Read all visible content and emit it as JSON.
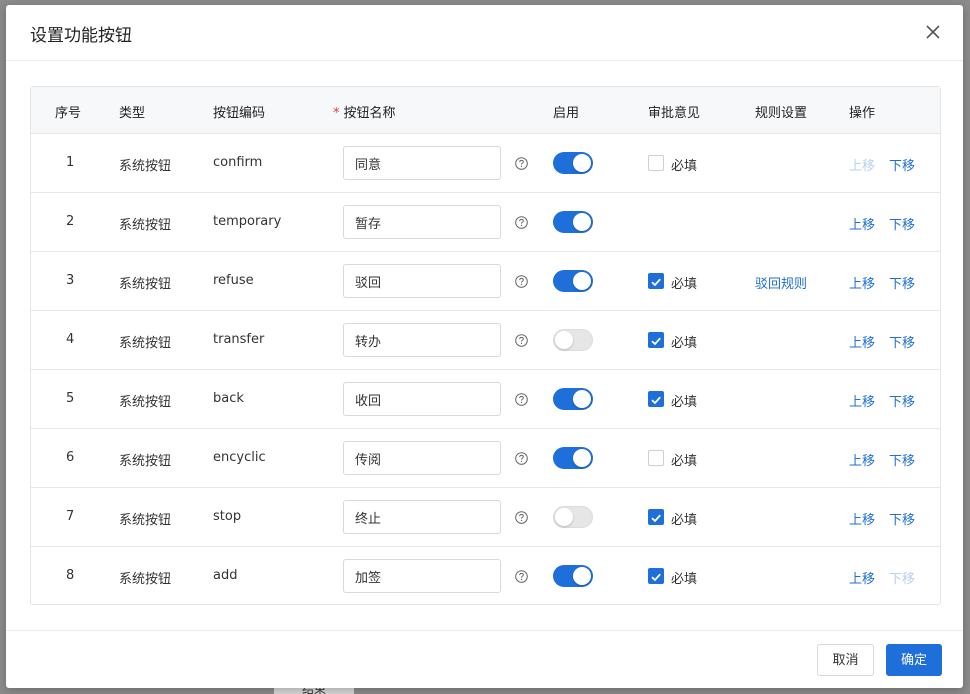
{
  "background": {
    "hint_text": "结束"
  },
  "dialog": {
    "title": "设置功能按钮",
    "close_icon": "close-icon"
  },
  "columns": {
    "index": "序号",
    "type": "类型",
    "code": "按钮编码",
    "required_mark": "*",
    "name": "按钮名称",
    "enabled": "启用",
    "opinion": "审批意见",
    "rules": "规则设置",
    "actions": "操作"
  },
  "labels": {
    "required": "必填",
    "move_up": "上移",
    "move_down": "下移"
  },
  "colors": {
    "accent": "#1e6fd9",
    "disabled_link": "#b8d0f0"
  },
  "rows": [
    {
      "index": "1",
      "type": "系统按钮",
      "code": "confirm",
      "name": "同意",
      "enabled": true,
      "opinion": "unchecked",
      "rule": "",
      "up_enabled": false,
      "down_enabled": true
    },
    {
      "index": "2",
      "type": "系统按钮",
      "code": "temporary",
      "name": "暂存",
      "enabled": true,
      "opinion": "none",
      "rule": "",
      "up_enabled": true,
      "down_enabled": true
    },
    {
      "index": "3",
      "type": "系统按钮",
      "code": "refuse",
      "name": "驳回",
      "enabled": true,
      "opinion": "checked",
      "rule": "驳回规则",
      "up_enabled": true,
      "down_enabled": true
    },
    {
      "index": "4",
      "type": "系统按钮",
      "code": "transfer",
      "name": "转办",
      "enabled": false,
      "opinion": "checked",
      "rule": "",
      "up_enabled": true,
      "down_enabled": true
    },
    {
      "index": "5",
      "type": "系统按钮",
      "code": "back",
      "name": "收回",
      "enabled": true,
      "opinion": "checked",
      "rule": "",
      "up_enabled": true,
      "down_enabled": true
    },
    {
      "index": "6",
      "type": "系统按钮",
      "code": "encyclic",
      "name": "传阅",
      "enabled": true,
      "opinion": "unchecked",
      "rule": "",
      "up_enabled": true,
      "down_enabled": true
    },
    {
      "index": "7",
      "type": "系统按钮",
      "code": "stop",
      "name": "终止",
      "enabled": false,
      "opinion": "checked",
      "rule": "",
      "up_enabled": true,
      "down_enabled": true
    },
    {
      "index": "8",
      "type": "系统按钮",
      "code": "add",
      "name": "加签",
      "enabled": true,
      "opinion": "checked",
      "rule": "",
      "up_enabled": true,
      "down_enabled": false
    }
  ],
  "footer": {
    "cancel_label": "取消",
    "ok_label": "确定"
  }
}
